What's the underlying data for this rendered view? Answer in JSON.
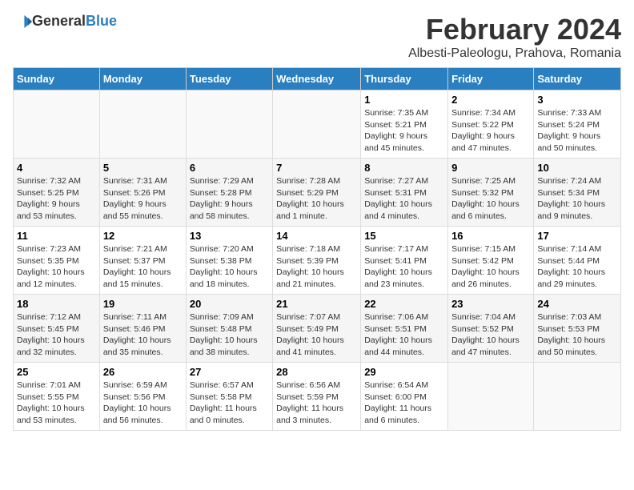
{
  "header": {
    "logo_general": "General",
    "logo_blue": "Blue",
    "title": "February 2024",
    "subtitle": "Albesti-Paleologu, Prahova, Romania"
  },
  "weekdays": [
    "Sunday",
    "Monday",
    "Tuesday",
    "Wednesday",
    "Thursday",
    "Friday",
    "Saturday"
  ],
  "weeks": [
    [
      {
        "day": "",
        "info": ""
      },
      {
        "day": "",
        "info": ""
      },
      {
        "day": "",
        "info": ""
      },
      {
        "day": "",
        "info": ""
      },
      {
        "day": "1",
        "info": "Sunrise: 7:35 AM\nSunset: 5:21 PM\nDaylight: 9 hours\nand 45 minutes."
      },
      {
        "day": "2",
        "info": "Sunrise: 7:34 AM\nSunset: 5:22 PM\nDaylight: 9 hours\nand 47 minutes."
      },
      {
        "day": "3",
        "info": "Sunrise: 7:33 AM\nSunset: 5:24 PM\nDaylight: 9 hours\nand 50 minutes."
      }
    ],
    [
      {
        "day": "4",
        "info": "Sunrise: 7:32 AM\nSunset: 5:25 PM\nDaylight: 9 hours\nand 53 minutes."
      },
      {
        "day": "5",
        "info": "Sunrise: 7:31 AM\nSunset: 5:26 PM\nDaylight: 9 hours\nand 55 minutes."
      },
      {
        "day": "6",
        "info": "Sunrise: 7:29 AM\nSunset: 5:28 PM\nDaylight: 9 hours\nand 58 minutes."
      },
      {
        "day": "7",
        "info": "Sunrise: 7:28 AM\nSunset: 5:29 PM\nDaylight: 10 hours\nand 1 minute."
      },
      {
        "day": "8",
        "info": "Sunrise: 7:27 AM\nSunset: 5:31 PM\nDaylight: 10 hours\nand 4 minutes."
      },
      {
        "day": "9",
        "info": "Sunrise: 7:25 AM\nSunset: 5:32 PM\nDaylight: 10 hours\nand 6 minutes."
      },
      {
        "day": "10",
        "info": "Sunrise: 7:24 AM\nSunset: 5:34 PM\nDaylight: 10 hours\nand 9 minutes."
      }
    ],
    [
      {
        "day": "11",
        "info": "Sunrise: 7:23 AM\nSunset: 5:35 PM\nDaylight: 10 hours\nand 12 minutes."
      },
      {
        "day": "12",
        "info": "Sunrise: 7:21 AM\nSunset: 5:37 PM\nDaylight: 10 hours\nand 15 minutes."
      },
      {
        "day": "13",
        "info": "Sunrise: 7:20 AM\nSunset: 5:38 PM\nDaylight: 10 hours\nand 18 minutes."
      },
      {
        "day": "14",
        "info": "Sunrise: 7:18 AM\nSunset: 5:39 PM\nDaylight: 10 hours\nand 21 minutes."
      },
      {
        "day": "15",
        "info": "Sunrise: 7:17 AM\nSunset: 5:41 PM\nDaylight: 10 hours\nand 23 minutes."
      },
      {
        "day": "16",
        "info": "Sunrise: 7:15 AM\nSunset: 5:42 PM\nDaylight: 10 hours\nand 26 minutes."
      },
      {
        "day": "17",
        "info": "Sunrise: 7:14 AM\nSunset: 5:44 PM\nDaylight: 10 hours\nand 29 minutes."
      }
    ],
    [
      {
        "day": "18",
        "info": "Sunrise: 7:12 AM\nSunset: 5:45 PM\nDaylight: 10 hours\nand 32 minutes."
      },
      {
        "day": "19",
        "info": "Sunrise: 7:11 AM\nSunset: 5:46 PM\nDaylight: 10 hours\nand 35 minutes."
      },
      {
        "day": "20",
        "info": "Sunrise: 7:09 AM\nSunset: 5:48 PM\nDaylight: 10 hours\nand 38 minutes."
      },
      {
        "day": "21",
        "info": "Sunrise: 7:07 AM\nSunset: 5:49 PM\nDaylight: 10 hours\nand 41 minutes."
      },
      {
        "day": "22",
        "info": "Sunrise: 7:06 AM\nSunset: 5:51 PM\nDaylight: 10 hours\nand 44 minutes."
      },
      {
        "day": "23",
        "info": "Sunrise: 7:04 AM\nSunset: 5:52 PM\nDaylight: 10 hours\nand 47 minutes."
      },
      {
        "day": "24",
        "info": "Sunrise: 7:03 AM\nSunset: 5:53 PM\nDaylight: 10 hours\nand 50 minutes."
      }
    ],
    [
      {
        "day": "25",
        "info": "Sunrise: 7:01 AM\nSunset: 5:55 PM\nDaylight: 10 hours\nand 53 minutes."
      },
      {
        "day": "26",
        "info": "Sunrise: 6:59 AM\nSunset: 5:56 PM\nDaylight: 10 hours\nand 56 minutes."
      },
      {
        "day": "27",
        "info": "Sunrise: 6:57 AM\nSunset: 5:58 PM\nDaylight: 11 hours\nand 0 minutes."
      },
      {
        "day": "28",
        "info": "Sunrise: 6:56 AM\nSunset: 5:59 PM\nDaylight: 11 hours\nand 3 minutes."
      },
      {
        "day": "29",
        "info": "Sunrise: 6:54 AM\nSunset: 6:00 PM\nDaylight: 11 hours\nand 6 minutes."
      },
      {
        "day": "",
        "info": ""
      },
      {
        "day": "",
        "info": ""
      }
    ]
  ]
}
